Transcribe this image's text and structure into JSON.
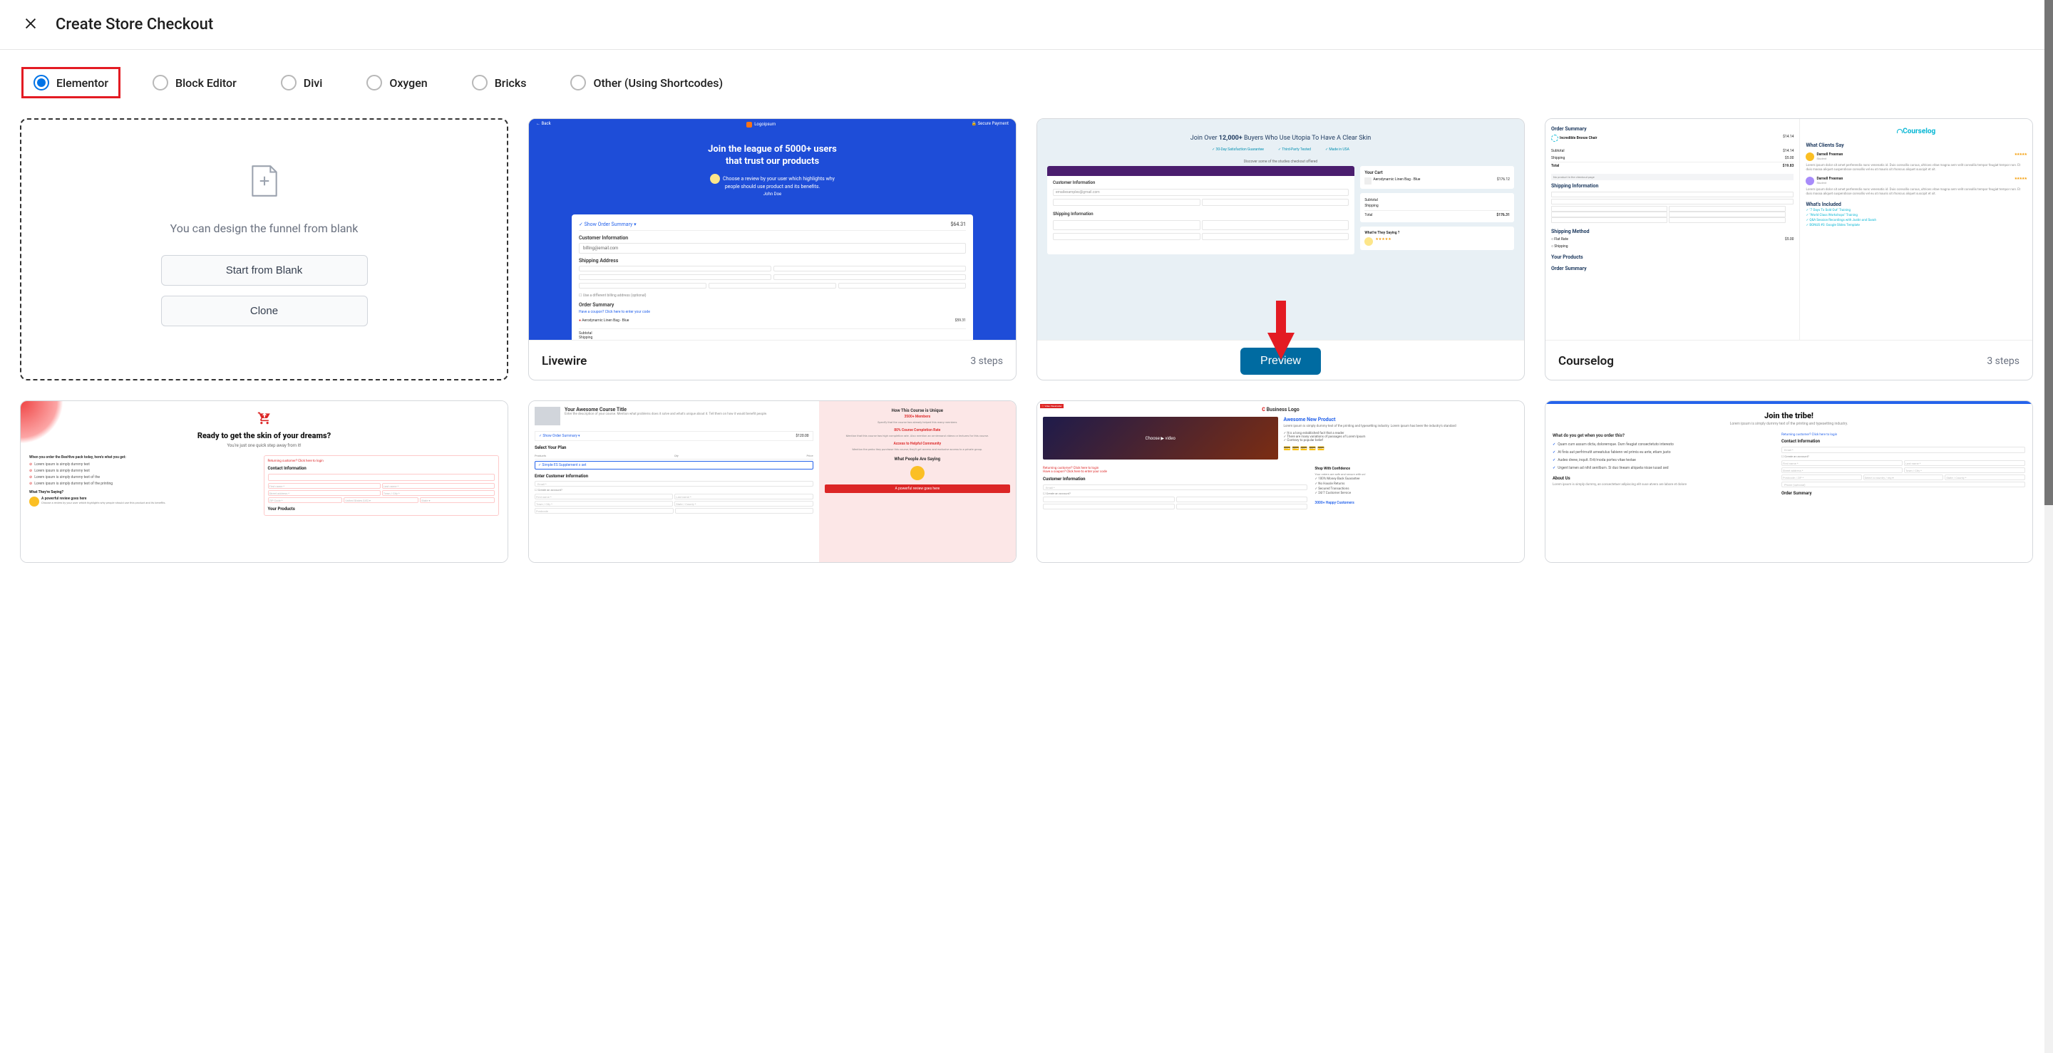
{
  "header": {
    "title": "Create Store Checkout"
  },
  "tabs": [
    {
      "id": "elementor",
      "label": "Elementor",
      "selected": true
    },
    {
      "id": "block-editor",
      "label": "Block Editor",
      "selected": false
    },
    {
      "id": "divi",
      "label": "Divi",
      "selected": false
    },
    {
      "id": "oxygen",
      "label": "Oxygen",
      "selected": false
    },
    {
      "id": "bricks",
      "label": "Bricks",
      "selected": false
    },
    {
      "id": "other",
      "label": "Other (Using Shortcodes)",
      "selected": false
    }
  ],
  "blank_card": {
    "text": "You can design the funnel from blank",
    "start_label": "Start from Blank",
    "clone_label": "Clone"
  },
  "templates": {
    "livewire": {
      "name": "Livewire",
      "steps": "3 steps",
      "preview": {
        "back": "← Back",
        "logo": "Logoipsum",
        "secure": "🔒 Secure Payment",
        "headline1": "Join the league of 5000+ users",
        "headline2": "that trust our products",
        "review": "Choose a review by your user which highlights why people should use product and its benefits.",
        "reviewer": "John Doe",
        "summary_label": "✓ Show Order Summary ▾",
        "summary_price": "$64.31",
        "section1": "Customer Information",
        "email": "billing@email.com",
        "section2": "Shipping Address",
        "checkbox": "☐ Use a different billing address (optional)",
        "section3": "Order Summary",
        "coupon": "Have a coupon? Click here to enter your code",
        "item": "Aerodynamic Linen Bag - Blue",
        "item_price": "$59.31",
        "subtotal": "Subtotal",
        "shipping": "Shipping"
      }
    },
    "utopia": {
      "preview_button": "Preview",
      "preview": {
        "headline_pre": "Join Over ",
        "headline_num": "12,000+",
        "headline_post": " Buyers Who Use Utopia To Have A Clear Skin",
        "benefit1": "✓ 30-Day Satisfaction Guarantee",
        "benefit2": "✓ Third-Party Tested",
        "benefit3": "✓ Made in USA",
        "banner": "Discover some of the studies checkout offered",
        "cart_title": "Your Cart",
        "cart_item": "Aerodynamic Linen Bag - Blue",
        "cart_price": "$176.12",
        "subtotal": "Subtotal",
        "shipping": "Shipping",
        "total": "Total",
        "total_price": "$176.31",
        "sec_customer": "Customer Information",
        "email": "emailexamples@gmail.com",
        "sec_shipping": "Shipping Information",
        "review_title": "What're They Saying ?",
        "stars": "★★★★★"
      }
    },
    "courselog": {
      "name": "Courselog",
      "steps": "3 steps",
      "preview": {
        "logo": "Courselog",
        "order_summary": "Order Summary",
        "item": "Incredible Bronze Chair",
        "item_price": "$14.14",
        "subtotal": "Subtotal",
        "subtotal_val": "$14.14",
        "shipping": "Shipping",
        "shipping_val": "$5.00",
        "total": "Total",
        "total_val": "$19.83",
        "promo": "No product in the checkout page",
        "sec_shipping_info": "Shipping Information",
        "sec_shipping_method": "Shipping Method",
        "flat": "Flat Rate",
        "flat_val": "$5.00",
        "sec_products": "Your Products",
        "sec_order": "Order Summary",
        "clients_say": "What Clients Say",
        "reviewer1": "Darnell Freeman",
        "role1": "Student",
        "stars": "★★★★★",
        "review_text": "Lorem ipsum dolor sit amet perferendis nunc venenatis id. Duis convallis cursus, ultrices vitae magna sem velit convallis tempor feugiat tempor non. Et duis massa aliquet suspendisse convallis vel eu at mauris sit rhoncus aliquet suscipit et sit.",
        "included": "What's Included",
        "inc1": "✓ \"7 Days To Sold Out\" Training",
        "inc2": "✓ \"World Class Workshops\" Training",
        "inc3": "✓ Q&A Session Recordings with Justin and Sarah",
        "inc4": "✓ BONUS #3: Google Slides Template"
      }
    },
    "beehive": {
      "preview": {
        "headline": "Ready to get the skin of your dreams?",
        "sub": "You're just one quick step away from it!",
        "when_order": "When you order the BeeHive pack today, here's what you get:",
        "bullet1": "Lorem ipsum is simply dummy text",
        "bullet2": "Lorem ipsum is simply dummy text",
        "bullet3": "Lorem ipsum is simply dummy text of the",
        "bullet4": "Lorem ipsum is simply dummy text of the printing",
        "saying": "What They're Saying?",
        "review": "A powerful review goes here",
        "review_text": "Choose a review by your user which highlights why people should use this product and its benefits.",
        "returning": "Returning customer? Click here to login",
        "contact": "Contact Information",
        "products": "Your Products"
      }
    },
    "course": {
      "preview": {
        "title": "Your Awesome Course Title",
        "desc": "Enter the description of your course. Mention what problems does it solve and what's unique about it. Tell them on how it would benefit people.",
        "order_sum": "✓ Show Order Summary ▾",
        "price": "$120.00",
        "select_plan": "Select Your Plan",
        "plan_item": "✓ Simple ES Supplement x set",
        "enter_info": "Enter Customer Information",
        "unique": "How This Course is Unique",
        "members": "3500+ Members",
        "members_desc": "Specify that the course has already helped this many members",
        "completion": "80% Course Completion Rate",
        "completion_desc": "Mention that this course has high completion rate. Also mention an on-demand videos or lectures for this course.",
        "community": "Access to Helpful Community",
        "community_desc": "Mention the perks they purchase this course; they'll get access and exclusive access to a private group.",
        "people_say": "What People Are Saying",
        "review": "A powerful review goes here"
      }
    },
    "awesome": {
      "preview": {
        "logo": "Business Logo",
        "video": "Choose ▶ video",
        "title": "Awesome New Product",
        "desc": "Lorem ipsum is simply dummy text of the printing and typesetting industry. Lorem ipsum has been the industry's standard",
        "fact1": "✓ It is a long established fact that a reader",
        "fact2": "✓ There are many variations of passages of Lorem Ipsum",
        "fact3": "✓ Contrary to popular belief",
        "returning": "Returning customer? Click here to login",
        "coupon": "Have a coupon? Click here to enter your code",
        "customer": "Customer Information",
        "confidence": "Shop With Confidence",
        "conf1": "Your orders are safe and secure with us!",
        "conf2": "✓ 100% Money Back Guarantee",
        "conf3": "✓ No Hassle Returns",
        "conf4": "✓ Secured Transactions",
        "conf5": "✓ 24/7 Customer Service",
        "happy": "3000+ Happy Customers"
      }
    },
    "tribe": {
      "preview": {
        "headline": "Join the tribe!",
        "sub": "Lorem ipsum is simply dummy text of the printing and typesetting industry.",
        "q": "What do you get when you order this?",
        "b1": "Quam cum assum dicta, doloremque. Dum feugiat consectetuto interesto",
        "b2": "At finis aut perfrimutit ameatulus fabienn vel primis eu ante, etiam justo",
        "b3": "Audeo dreve, inquit. Erit/moda portes vitae textae",
        "b4": "Urgent lamen ad nihil senilbum. Si duo lineam aliquela nisse iusad sed",
        "about": "About Us",
        "about_text": "Lorem ipsum is simply dummy, an consectetuer adipiscing elit suse atvero are labore et dolore",
        "returning": "Returning customer? Click here to login",
        "contact": "Contact Information",
        "order_sum": "Order Summary"
      }
    }
  }
}
